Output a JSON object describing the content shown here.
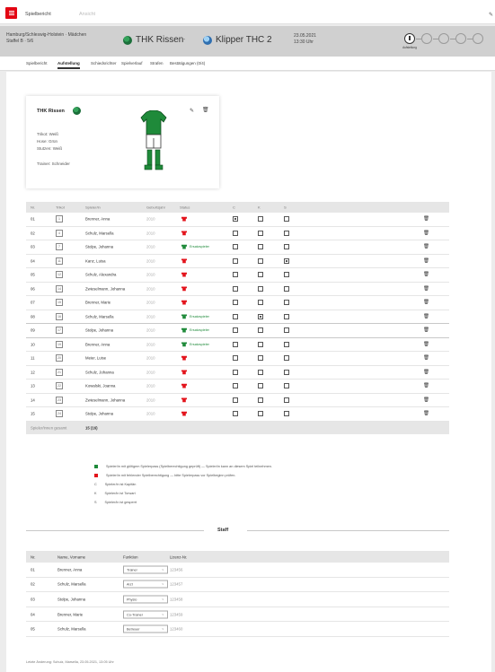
{
  "topbar": {
    "item1": "Spielbericht",
    "item2": "Ansicht"
  },
  "match": {
    "league_line1": "Hamburg/Schleswig-Holstein · Mädchen",
    "league_line2": "Staffel B · 5/6",
    "home": "THK Rissen",
    "sep": "-",
    "away": "Klipper THC 2",
    "date": "23.05.2021",
    "time": "13:30 Uhr",
    "step_label": "Aufstellung"
  },
  "tabs": [
    "Spielbericht",
    "Aufstellung",
    "Schiedsrichter",
    "Spielverlauf",
    "Strafen",
    "Bestätigungen (0/4)"
  ],
  "team_card": {
    "name": "THK Rissen",
    "lines": [
      "Trikot: Weiß",
      "Hose: Grün",
      "Stutzen: Weiß"
    ],
    "trainer": "Trainer: Schneider"
  },
  "roster": {
    "headers": [
      "Nr.",
      "Trikot",
      "Spieler/in",
      "Geburtsjahr",
      "Status",
      "C",
      "K",
      "S"
    ],
    "rows": [
      {
        "nr": "01",
        "num": "1",
        "name": "Brenner, Anna",
        "year": "2010",
        "status": "",
        "shirt": "red",
        "c": "on",
        "k": "",
        "s": ""
      },
      {
        "nr": "02",
        "num": "4",
        "name": "Schulz, Marsella",
        "year": "2010",
        "status": "",
        "shirt": "red",
        "c": "",
        "k": "",
        "s": ""
      },
      {
        "nr": "03",
        "num": "7",
        "name": "Stolpe, Johanna",
        "year": "2010",
        "status": "Ersatzspieler",
        "shirt": "green",
        "c": "",
        "k": "",
        "s": ""
      },
      {
        "nr": "04",
        "num": "11",
        "name": "Kanz, Luisa",
        "year": "2010",
        "status": "",
        "shirt": "red",
        "c": "",
        "k": "",
        "s": "on"
      },
      {
        "nr": "05",
        "num": "12",
        "name": "Schulz, Alexandra",
        "year": "2010",
        "status": "",
        "shirt": "red",
        "c": "",
        "k": "",
        "s": ""
      },
      {
        "nr": "06",
        "num": "14",
        "name": "Zwieselmann, Johanna",
        "year": "2010",
        "status": "",
        "shirt": "red",
        "c": "",
        "k": "",
        "s": ""
      },
      {
        "nr": "07",
        "num": "15",
        "name": "Brenner, Marie",
        "year": "2010",
        "status": "",
        "shirt": "red",
        "c": "",
        "k": "",
        "s": ""
      },
      {
        "nr": "08",
        "num": "16",
        "name": "Schulz, Marsella",
        "year": "2010",
        "status": "Ersatzspieler",
        "shirt": "green",
        "c": "",
        "k": "on",
        "s": ""
      },
      {
        "nr": "09",
        "num": "17",
        "name": "Stolpe, Johanna",
        "year": "2010",
        "status": "Ersatzspieler",
        "shirt": "green",
        "c": "",
        "k": "",
        "s": ""
      },
      {
        "nr": "10",
        "num": "19",
        "name": "Brenner, Anna",
        "year": "2010",
        "status": "Ersatzspieler",
        "shirt": "green",
        "c": "",
        "k": "",
        "s": ""
      },
      {
        "nr": "11",
        "num": "20",
        "name": "Meier, Luise",
        "year": "2010",
        "status": "",
        "shirt": "red",
        "c": "",
        "k": "",
        "s": ""
      },
      {
        "nr": "12",
        "num": "21",
        "name": "Schulz, Johanna",
        "year": "2010",
        "status": "",
        "shirt": "red",
        "c": "",
        "k": "",
        "s": ""
      },
      {
        "nr": "13",
        "num": "22",
        "name": "Kowalski, Joanna",
        "year": "2010",
        "status": "",
        "shirt": "red",
        "c": "",
        "k": "",
        "s": ""
      },
      {
        "nr": "14",
        "num": "23",
        "name": "Zwieselmann, Johanna",
        "year": "2010",
        "status": "",
        "shirt": "red",
        "c": "",
        "k": "",
        "s": ""
      },
      {
        "nr": "15",
        "num": "24",
        "name": "Stolpe, Johanna",
        "year": "2010",
        "status": "",
        "shirt": "red",
        "c": "",
        "k": "",
        "s": ""
      }
    ],
    "footer_label": "Spieler/innen gesamt",
    "footer_value": "15 (16)"
  },
  "legend": [
    {
      "kind": "green",
      "text": "Spieler/in mit gültigem Spielerpass (Spielberechtigung geprüft) — Spieler/in kann an diesem Spiel teilnehmen."
    },
    {
      "kind": "red",
      "text": "Spieler/in mit fehlender Spielberechtigung — bitte Spielerpass vor Spielbeginn prüfen."
    },
    {
      "kind": "letter",
      "mark": "C",
      "text": "Spieler/in ist Kapitän"
    },
    {
      "kind": "letter",
      "mark": "K",
      "text": "Spieler/in ist Torwart"
    },
    {
      "kind": "letter",
      "mark": "S",
      "text": "Spieler/in ist gesperrt"
    }
  ],
  "staff": {
    "title": "Staff",
    "headers": [
      "Nr.",
      "Name, Vorname",
      "Funktion",
      "Lizenz-Nr."
    ],
    "rows": [
      {
        "nr": "01",
        "name": "Brenner, Anna",
        "role": "Trainer",
        "lic": "123456"
      },
      {
        "nr": "02",
        "name": "Schulz, Marsella",
        "role": "Arzt",
        "lic": "123457"
      },
      {
        "nr": "03",
        "name": "Stolpe, Johanna",
        "role": "Physio",
        "lic": "123458"
      },
      {
        "nr": "04",
        "name": "Brenner, Marie",
        "role": "Co-Trainer",
        "lic": "123459"
      },
      {
        "nr": "05",
        "name": "Schulz, Marsella",
        "role": "Betreuer",
        "lic": "123460"
      }
    ]
  },
  "footer": "Letzte Änderung: Schulz, Marsella, 23.05.2021, 13:05 Uhr",
  "colors": {
    "accent": "#e30613",
    "green": "#1f8a3a",
    "red": "#e3131b"
  }
}
